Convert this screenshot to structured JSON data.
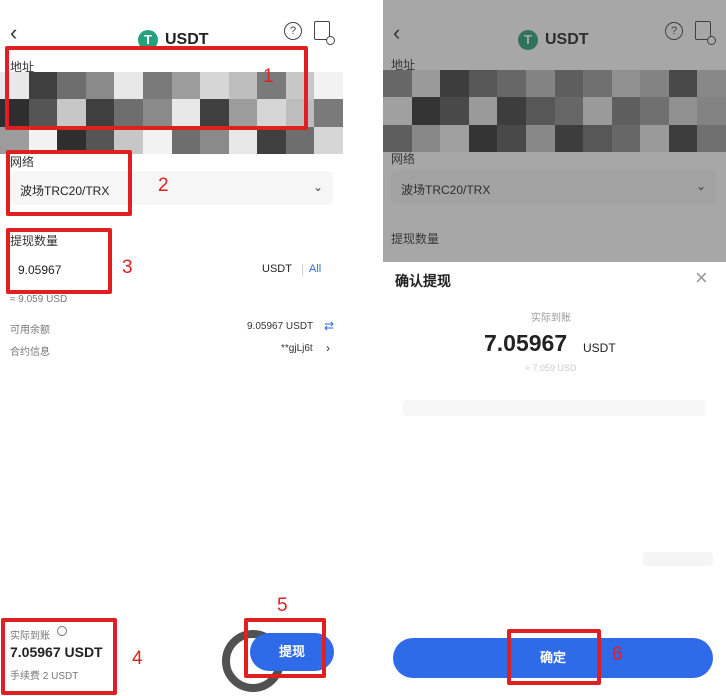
{
  "left": {
    "title": "USDT",
    "back_icon": "chevron-left-icon",
    "coin_glyph": "T",
    "help_glyph": "?",
    "address_label": "地址",
    "network_label": "网络",
    "network_value": "波场TRC20/TRX",
    "amount_label": "提现数量",
    "amount_value": "9.05967",
    "amount_unit": "USDT",
    "all_label": "All",
    "fiat_approx": "≈ 9.059 USD",
    "available_label": "可用余额",
    "available_value": "9.05967 USDT",
    "swap_glyph": "⇄",
    "contract_label": "合约信息",
    "contract_value": "**gjLj6t",
    "received_label": "实际到账",
    "received_value": "7.05967 USDT",
    "fee_text": "手续费 2 USDT",
    "withdraw_button": "提现",
    "step_numbers": [
      "1",
      "2",
      "3",
      "4",
      "5"
    ]
  },
  "right": {
    "title": "USDT",
    "coin_glyph": "T",
    "help_glyph": "?",
    "address_label": "地址",
    "network_label": "网络",
    "network_value": "波场TRC20/TRX",
    "amount_label": "提现数量",
    "dialog_title": "确认提现",
    "close_glyph": "×",
    "received_label": "实际到账",
    "received_amount": "7.05967",
    "received_unit": "USDT",
    "received_fiat": "≈ 7.059 USD",
    "confirm_button": "确定",
    "step_number": "6"
  },
  "colors": {
    "primary": "#2f6ae8",
    "annotation": "#e02020",
    "usdt_green": "#26a17b"
  }
}
